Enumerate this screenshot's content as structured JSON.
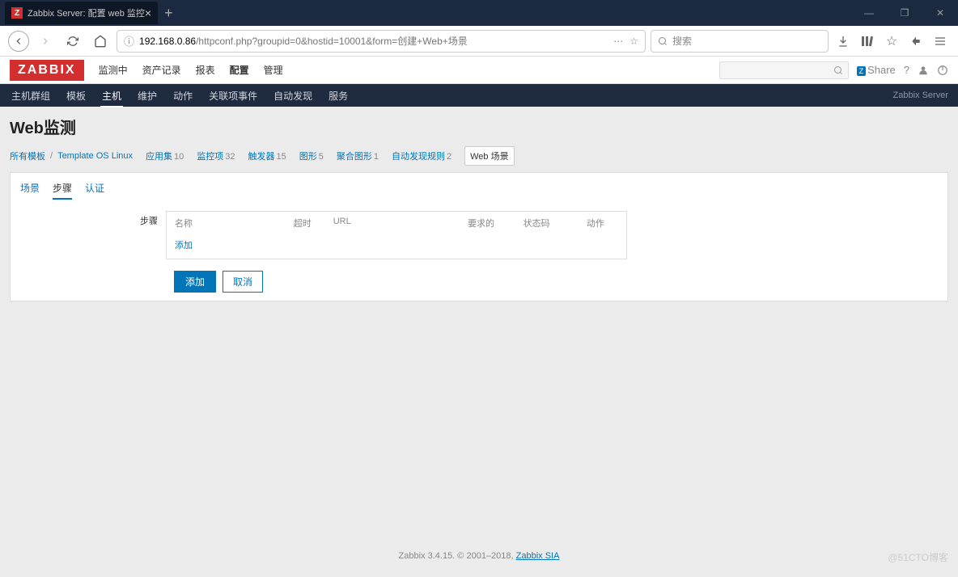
{
  "browser": {
    "tab_title": "Zabbix Server: 配置 web 监控",
    "url_domain": "192.168.0.86",
    "url_path": "/httpconf.php?groupid=0&hostid=10001&form=创建+Web+场景",
    "search_placeholder": "搜索"
  },
  "zabbix": {
    "logo": "ZABBIX",
    "nav": [
      "监测中",
      "资产记录",
      "报表",
      "配置",
      "管理"
    ],
    "nav_active": "配置",
    "share": "Share",
    "server_label": "Zabbix Server"
  },
  "subnav": {
    "items": [
      "主机群组",
      "模板",
      "主机",
      "维护",
      "动作",
      "关联项事件",
      "自动发现",
      "服务"
    ],
    "active": "主机"
  },
  "page": {
    "title": "Web监测",
    "breadcrumb": {
      "all_templates": "所有模板",
      "template": "Template OS Linux"
    },
    "filters": [
      {
        "label": "应用集",
        "count": "10"
      },
      {
        "label": "监控项",
        "count": "32"
      },
      {
        "label": "触发器",
        "count": "15"
      },
      {
        "label": "图形",
        "count": "5"
      },
      {
        "label": "聚合图形",
        "count": "1"
      },
      {
        "label": "自动发现规则",
        "count": "2"
      },
      {
        "label": "Web 场景",
        "count": "",
        "selected": true
      }
    ]
  },
  "tabs": {
    "items": [
      "场景",
      "步骤",
      "认证"
    ],
    "active": "步骤"
  },
  "form": {
    "step_label": "步骤",
    "columns": {
      "name": "名称",
      "timeout": "超时",
      "url": "URL",
      "required": "要求的",
      "status": "状态码",
      "action": "动作"
    },
    "add_link": "添加",
    "btn_add": "添加",
    "btn_cancel": "取消"
  },
  "footer": {
    "text": "Zabbix 3.4.15. © 2001–2018, ",
    "link": "Zabbix SIA"
  },
  "watermark": "@51CTO博客"
}
